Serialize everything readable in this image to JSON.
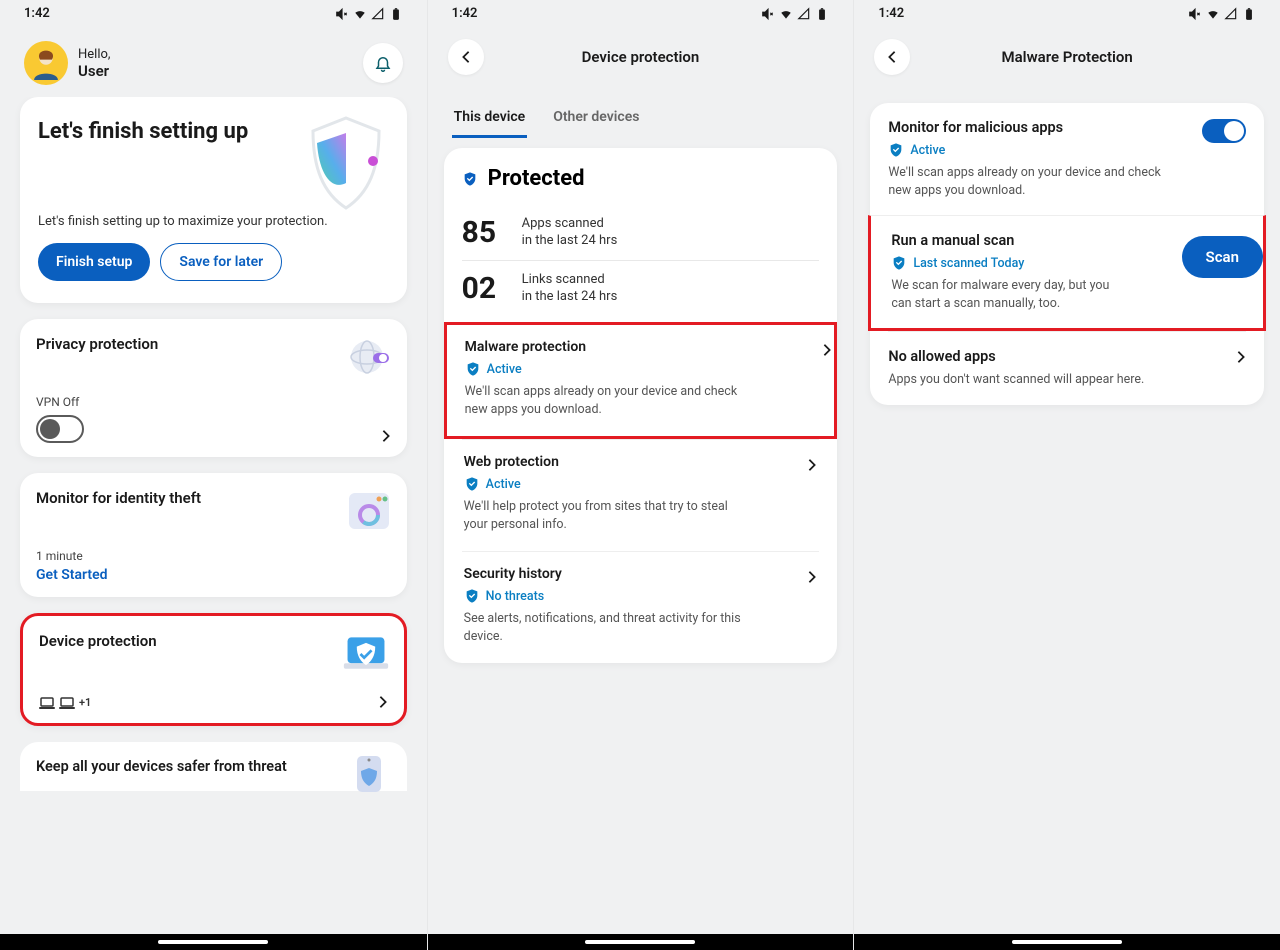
{
  "status_bar": {
    "time": "1:42"
  },
  "screen1": {
    "greeting_small": "Hello,",
    "greeting_name": "User",
    "setup": {
      "title": "Let's finish setting up",
      "text": "Let's finish setting up to maximize your protection.",
      "finish_btn": "Finish setup",
      "later_btn": "Save for later"
    },
    "privacy": {
      "title": "Privacy protection",
      "vpn_label": "VPN Off"
    },
    "identity": {
      "title": "Monitor for identity theft",
      "sub": "1 minute",
      "link": "Get Started"
    },
    "device": {
      "title": "Device protection",
      "plus": "+1"
    },
    "partial": {
      "title": "Keep all your devices safer from threat"
    }
  },
  "screen2": {
    "page_title": "Device protection",
    "tabs": {
      "this": "This device",
      "other": "Other devices"
    },
    "protected_label": "Protected",
    "stats": {
      "apps_num": "85",
      "apps_l1": "Apps scanned",
      "apps_l2": "in the last 24 hrs",
      "links_num": "02",
      "links_l1": "Links scanned",
      "links_l2": "in the last 24 hrs"
    },
    "malware": {
      "title": "Malware protection",
      "status": "Active",
      "desc": "We'll scan apps already on your device and check new apps you download."
    },
    "web": {
      "title": "Web protection",
      "status": "Active",
      "desc": "We'll help protect you from sites that try to steal your personal info."
    },
    "history": {
      "title": "Security history",
      "status": "No threats",
      "desc": "See alerts, notifications, and threat activity for this device."
    }
  },
  "screen3": {
    "page_title": "Malware Protection",
    "monitor": {
      "title": "Monitor for malicious apps",
      "status": "Active",
      "desc": "We'll scan apps already on your device and check new apps you download."
    },
    "manual": {
      "title": "Run a manual scan",
      "status": "Last scanned Today",
      "desc": "We scan for malware every day, but you can start a scan manually, too.",
      "btn": "Scan"
    },
    "allowed": {
      "title": "No allowed apps",
      "desc": "Apps you don't want scanned will appear here."
    }
  }
}
